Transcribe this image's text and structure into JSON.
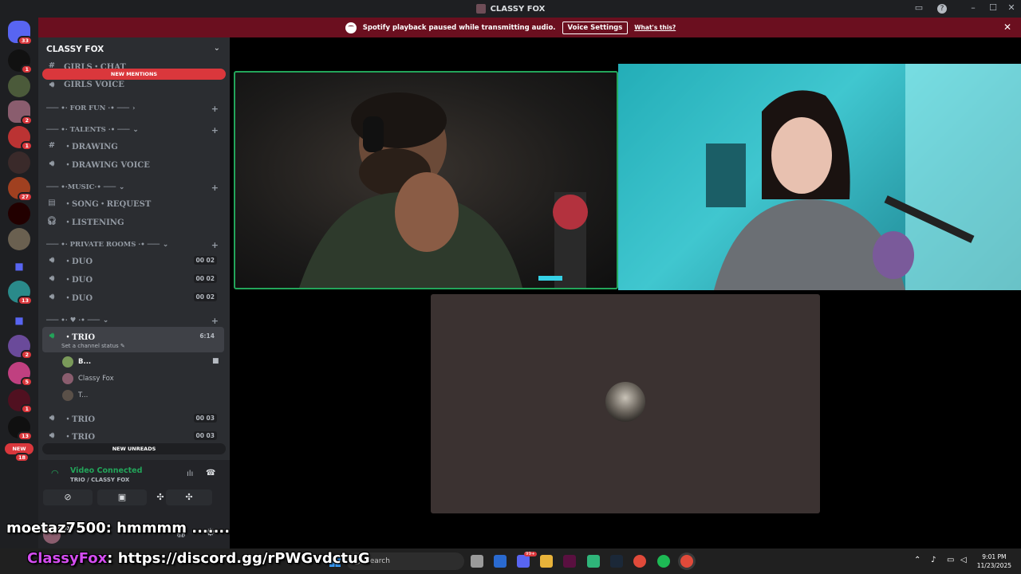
{
  "window": {
    "title": "CLASSY FOX"
  },
  "notice": {
    "text": "Spotify playback paused while transmitting audio.",
    "button": "Voice Settings",
    "link": "What's this?"
  },
  "servers": {
    "badges": [
      "33",
      "1",
      "2",
      "1",
      "27",
      "13",
      "2",
      "5",
      "1",
      "13",
      "18"
    ],
    "new_label": "NEW"
  },
  "guild": {
    "name": "CLASSY FOX"
  },
  "banners": {
    "new_mentions": "NEW MENTIONS",
    "new_unreads": "NEW UNREADS"
  },
  "channels": {
    "girls_chat": "GIRLS・CHAT",
    "girls_voice": "GIRLS VOICE",
    "cat_for_fun": "─── •· FOR FUN ·• ───",
    "cat_talents": "─── •· TALENTS ·• ───",
    "drawing": "・DRAWING",
    "drawing_voice": "・DRAWING VOICE",
    "cat_music": "─── •·MUSIC·• ───",
    "song_request": "・SONG・REQUEST",
    "listening": "・LISTENING",
    "cat_private": "─── •· PRIVATE ROOMS ·• ───",
    "duo": "・DUO",
    "duo_count": "00  02",
    "cat_heart": "─── •· ♥ ·• ───",
    "trio": "・TRIO",
    "trio_timer": "6:14",
    "trio_status": "Set a channel status",
    "trio_count": "00  03"
  },
  "voice_users": [
    "B...",
    "Classy Fox",
    "T..."
  ],
  "voice_panel": {
    "status": "Video Connected",
    "location": "TRIO / CLASSY FOX"
  },
  "user": {
    "name": "Classy Fox"
  },
  "overlay": {
    "chat_user": "moetaz7500",
    "chat_msg": ": hmmmm .......",
    "brand_user": "ClassyFox",
    "brand_msg": ": https://discord.gg/rPWGvdctuG"
  },
  "taskbar": {
    "search_placeholder": "Search",
    "time": "9:01 PM",
    "date": "11/23/2025",
    "tb_badge": "99+"
  },
  "colors": {
    "accent_red": "#da373c",
    "connected_green": "#23a55a",
    "notice_bg": "#6b0f1f"
  }
}
